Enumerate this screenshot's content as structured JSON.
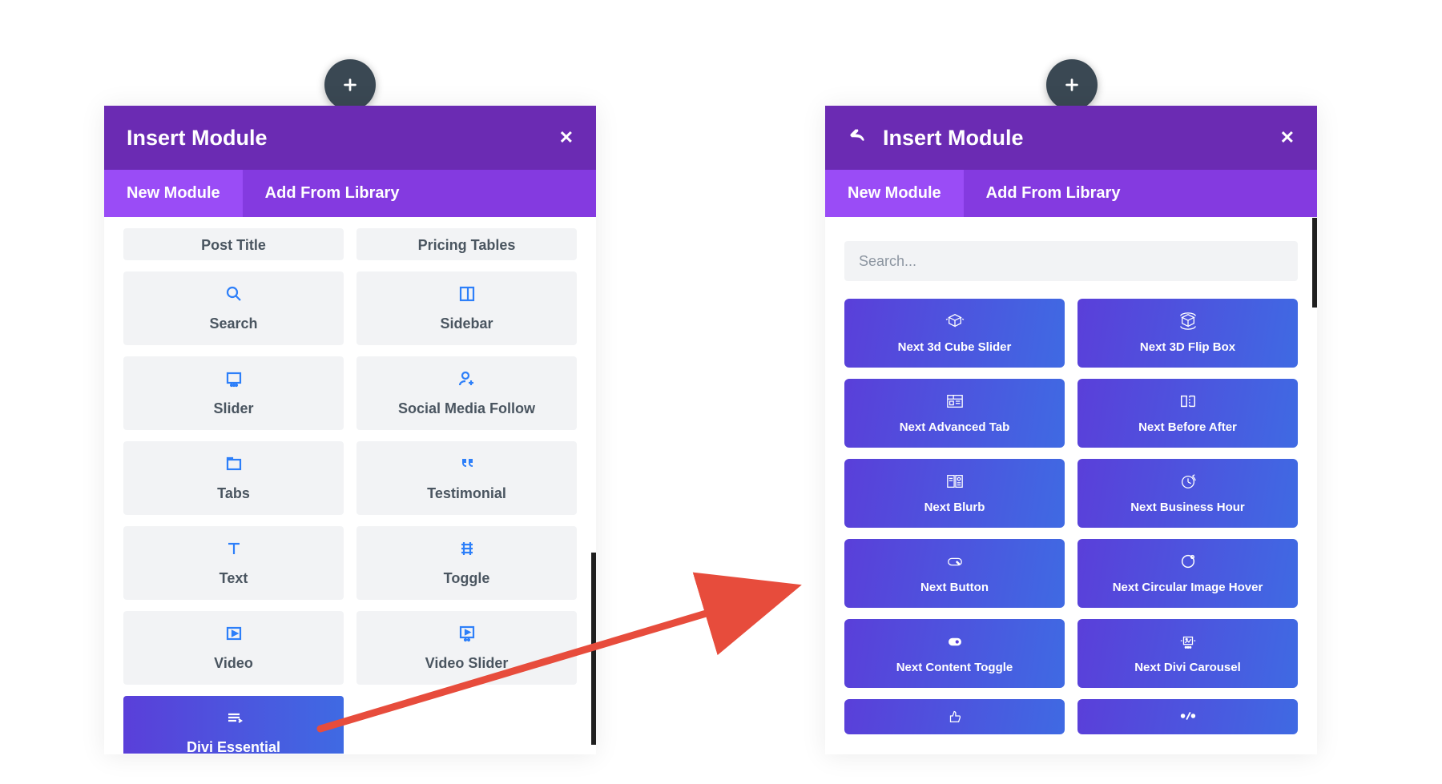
{
  "left": {
    "title": "Insert Module",
    "tabs": {
      "new": "New Module",
      "library": "Add From Library"
    },
    "modules_partial": [
      "Post Title",
      "Pricing Tables"
    ],
    "modules": [
      "Search",
      "Sidebar",
      "Slider",
      "Social Media Follow",
      "Tabs",
      "Testimonial",
      "Text",
      "Toggle",
      "Video",
      "Video Slider"
    ],
    "essential": "Divi Essential"
  },
  "right": {
    "title": "Insert Module",
    "tabs": {
      "new": "New Module",
      "library": "Add From Library"
    },
    "search_placeholder": "Search...",
    "modules": [
      "Next 3d Cube Slider",
      "Next 3D Flip Box",
      "Next Advanced Tab",
      "Next Before After",
      "Next Blurb",
      "Next Business Hour",
      "Next Button",
      "Next Circular Image Hover",
      "Next Content Toggle",
      "Next Divi Carousel"
    ]
  }
}
